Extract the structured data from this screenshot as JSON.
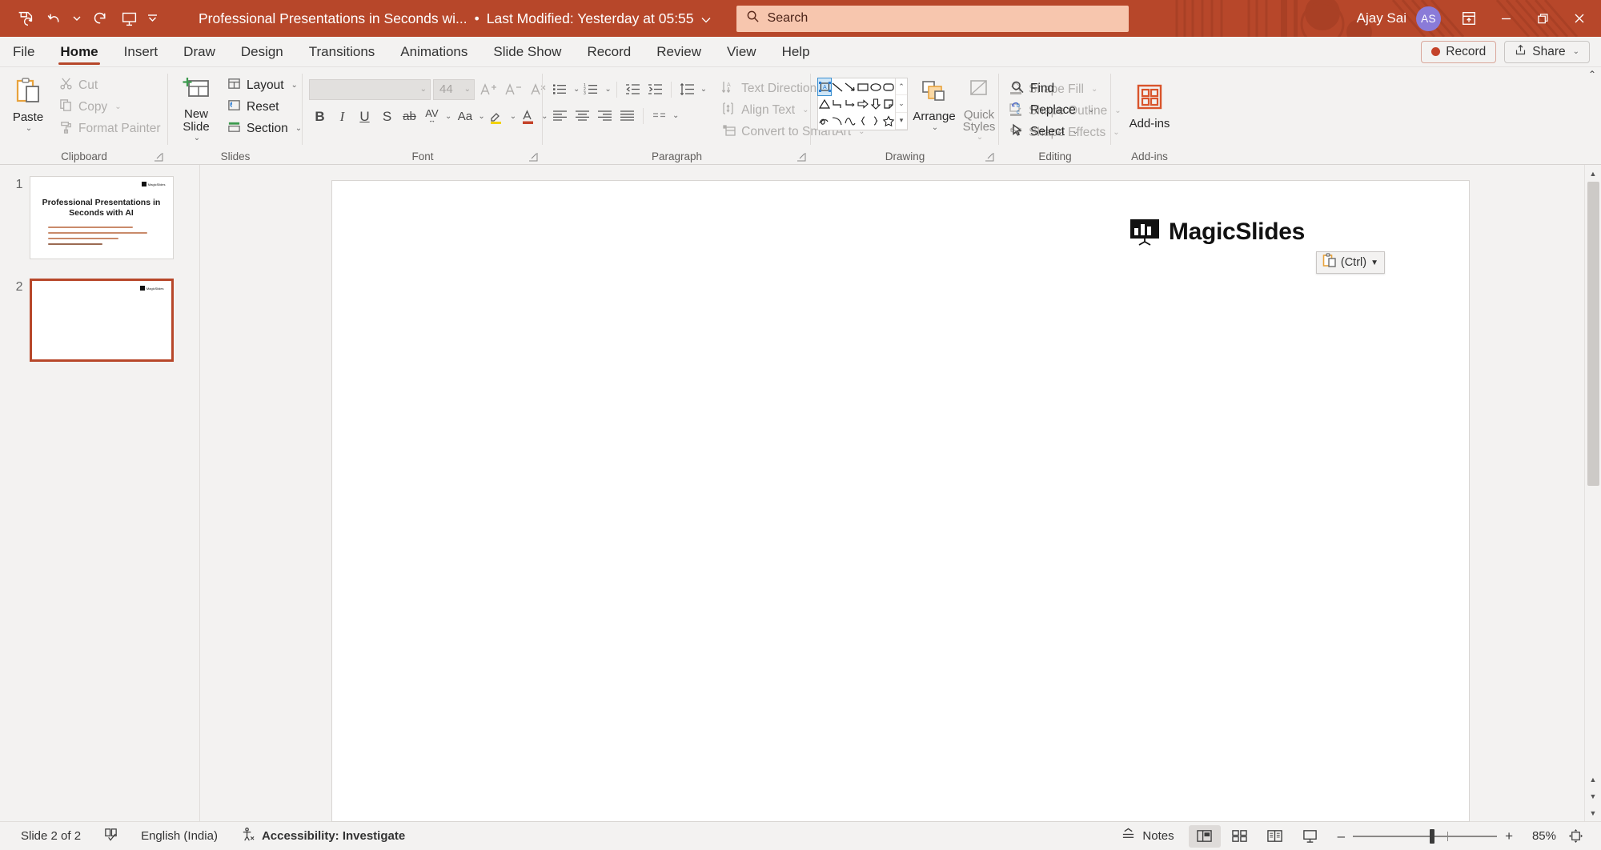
{
  "titlebar": {
    "quick_access": [
      {
        "name": "autosave-save-icon",
        "label": "Save"
      },
      {
        "name": "undo-icon",
        "label": "Undo"
      },
      {
        "name": "redo-icon",
        "label": "Redo"
      },
      {
        "name": "start-presentation-icon",
        "label": "Start From Beginning"
      },
      {
        "name": "customize-quick-access-toolbar-icon",
        "label": "Customize Quick Access Toolbar"
      }
    ],
    "doc_title": "Professional Presentations in Seconds wi...",
    "separator": "•",
    "modified": "Last Modified: Yesterday at 05:55",
    "search_placeholder": "Search",
    "user_name": "Ajay Sai",
    "user_initials": "AS",
    "accent": "#b7472a",
    "window": {
      "minimize": "–",
      "restore": "❐",
      "close": "✕"
    }
  },
  "tabs": [
    {
      "label": "File",
      "active": false
    },
    {
      "label": "Home",
      "active": true
    },
    {
      "label": "Insert",
      "active": false
    },
    {
      "label": "Draw",
      "active": false
    },
    {
      "label": "Design",
      "active": false
    },
    {
      "label": "Transitions",
      "active": false
    },
    {
      "label": "Animations",
      "active": false
    },
    {
      "label": "Slide Show",
      "active": false
    },
    {
      "label": "Record",
      "active": false
    },
    {
      "label": "Review",
      "active": false
    },
    {
      "label": "View",
      "active": false
    },
    {
      "label": "Help",
      "active": false
    }
  ],
  "tab_actions": {
    "record_label": "Record",
    "share_label": "Share"
  },
  "ribbon": {
    "clipboard": {
      "label": "Clipboard",
      "paste": "Paste",
      "cut": "Cut",
      "copy": "Copy",
      "format_painter": "Format Painter"
    },
    "slides": {
      "label": "Slides",
      "new_slide": "New Slide",
      "layout": "Layout",
      "reset": "Reset",
      "section": "Section"
    },
    "font": {
      "label": "Font",
      "font_name": "",
      "font_size": "44",
      "bold": "B",
      "italic": "I",
      "underline": "U",
      "shadow": "S",
      "strikethrough": "ab",
      "character_spacing": "AV",
      "change_case": "Aa"
    },
    "paragraph": {
      "label": "Paragraph",
      "text_direction": "Text Direction",
      "align_text": "Align Text",
      "convert_to_smartart": "Convert to SmartArt"
    },
    "drawing": {
      "label": "Drawing",
      "arrange": "Arrange",
      "quick_styles": "Quick Styles",
      "shape_fill": "Shape Fill",
      "shape_outline": "Shape Outline",
      "shape_effects": "Shape Effects"
    },
    "editing": {
      "label": "Editing",
      "find": "Find",
      "replace": "Replace",
      "select": "Select"
    },
    "addins": {
      "label": "Add-ins",
      "button": "Add-ins"
    }
  },
  "thumbnails": [
    {
      "number": "1",
      "selected": false,
      "title": "Professional Presentations in Seconds with AI",
      "logo": "MagicSlides"
    },
    {
      "number": "2",
      "selected": true,
      "title": "",
      "logo": "MagicSlides"
    }
  ],
  "slide": {
    "logo_text": "MagicSlides",
    "paste_options": {
      "label": "(Ctrl)",
      "icon": "paste-clipboard-icon"
    }
  },
  "status": {
    "slide_counter": "Slide 2 of 2",
    "language": "English (India)",
    "accessibility": "Accessibility: Investigate",
    "notes": "Notes",
    "zoom_percent": "85%",
    "views": [
      {
        "name": "normal-view",
        "active": true
      },
      {
        "name": "slide-sorter-view",
        "active": false
      },
      {
        "name": "reading-view",
        "active": false
      },
      {
        "name": "slide-show-view",
        "active": false
      }
    ],
    "zoom_out": "–",
    "zoom_in": "+"
  }
}
